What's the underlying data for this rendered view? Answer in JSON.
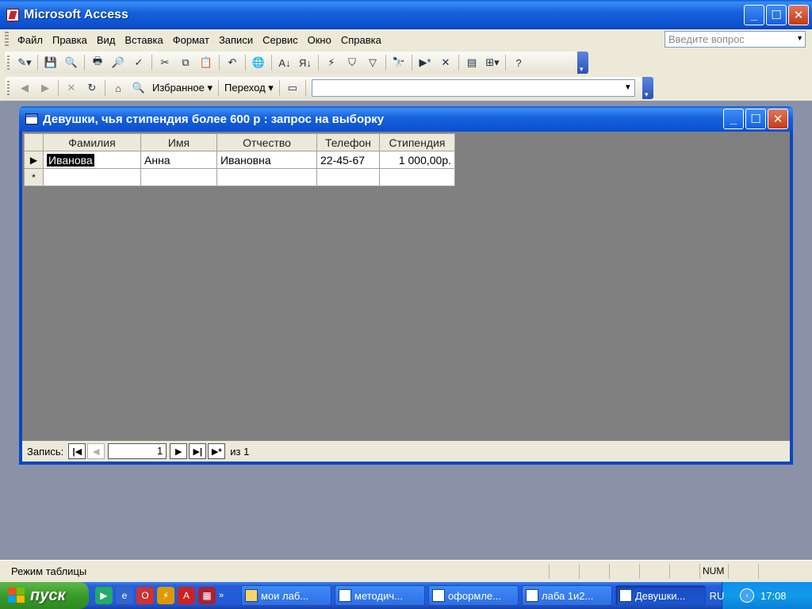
{
  "app": {
    "title": "Microsoft Access"
  },
  "menu": {
    "items": [
      "Файл",
      "Правка",
      "Вид",
      "Вставка",
      "Формат",
      "Записи",
      "Сервис",
      "Окно",
      "Справка"
    ],
    "ask_placeholder": "Введите вопрос"
  },
  "web_toolbar": {
    "favorites_label": "Избранное",
    "go_label": "Переход",
    "address_value": ""
  },
  "query_window": {
    "title": "Девушки, чья стипендия более 600 р : запрос на выборку",
    "columns": [
      "Фамилия",
      "Имя",
      "Отчество",
      "Телефон",
      "Стипендия"
    ],
    "rows": [
      {
        "Фамилия": "Иванова",
        "Имя": "Анна",
        "Отчество": "Ивановна",
        "Телефон": "22-45-67",
        "Стипендия": "1 000,00р."
      }
    ],
    "new_row_marker": "*",
    "current_row_marker": "▶",
    "record_nav": {
      "label": "Запись:",
      "current": "1",
      "of_label": "из 1"
    }
  },
  "statusbar": {
    "text": "Режим таблицы",
    "num_indicator": "NUM"
  },
  "taskbar": {
    "start_label": "пуск",
    "tasks": [
      "мои лаб...",
      "методич...",
      "оформле...",
      "лаба 1и2...",
      "Девушки..."
    ],
    "language": "RU",
    "clock": "17:08"
  },
  "colors": {
    "titlebar": "#1662dc",
    "workspace": "#8b92a8",
    "grid_background": "#808080",
    "start_button": "#3a9b2a"
  }
}
